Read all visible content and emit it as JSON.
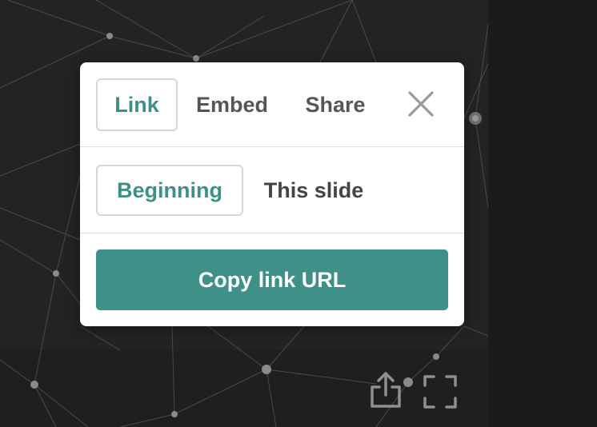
{
  "share_dialog": {
    "tabs": [
      {
        "label": "Link",
        "active": true
      },
      {
        "label": "Embed",
        "active": false
      },
      {
        "label": "Share",
        "active": false
      }
    ],
    "close_icon": "close-icon",
    "start_options": [
      {
        "label": "Beginning",
        "active": true
      },
      {
        "label": "This slide",
        "active": false
      }
    ],
    "copy_button_label": "Copy link URL"
  },
  "player_controls": {
    "share_icon": "share-icon",
    "fullscreen_icon": "fullscreen-icon"
  },
  "colors": {
    "accent": "#3f9087",
    "active_text": "#3e9086",
    "background": "#232323",
    "modal_background": "#ffffff"
  }
}
